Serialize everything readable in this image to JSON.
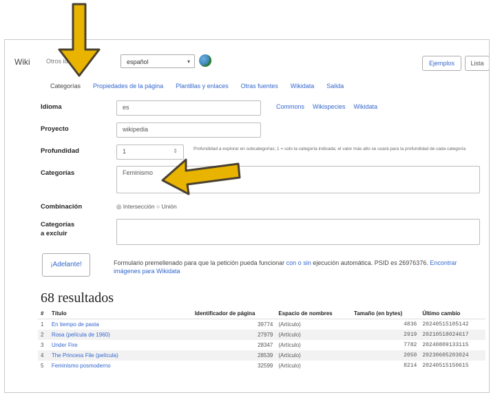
{
  "header": {
    "brand": "Wiki",
    "lang_label": "Otros idiomas",
    "lang_value": "español",
    "examples_btn": "Ejemplos",
    "list_btn": "Lista"
  },
  "tabs": [
    {
      "label": "Categorías",
      "active": true
    },
    {
      "label": "Propiedades de la página",
      "active": false
    },
    {
      "label": "Plantillas y enlaces",
      "active": false
    },
    {
      "label": "Otras fuentes",
      "active": false
    },
    {
      "label": "Wikidata",
      "active": false
    },
    {
      "label": "Salida",
      "active": false
    }
  ],
  "form": {
    "idioma_label": "Idioma",
    "idioma_value": "es",
    "links": [
      "Commons",
      "Wikispecies",
      "Wikidata"
    ],
    "proyecto_label": "Proyecto",
    "proyecto_value": "wikipedia",
    "profundidad_label": "Profundidad",
    "profundidad_value": "1",
    "profundidad_note": "Profundidad a explorar en subcategorías; 1 = solo la categoría indicada; el valor más alto se usará para la profundidad de cada categoría",
    "categorias_label": "Categorías",
    "categorias_value": "Feminismo",
    "combinacion_label": "Combinación",
    "combinacion_options": "◎ Intersección ○ Unión",
    "excluir_label_1": "Categorías",
    "excluir_label_2": "a excluir"
  },
  "action": {
    "go_button": "¡Adelante!",
    "prefill_text": "Formulario premellenado para que la petición pueda funcionar",
    "prefill_link1": "con o sin",
    "prefill_text2": "ejecución automática. PSID es 26976376.",
    "prefill_link2": "Encontrar imágenes para Wikidata"
  },
  "results": {
    "title": "68 resultados",
    "columns": [
      "#",
      "Título",
      "Identificador de página",
      "Espacio de nombres",
      "Tamaño (en bytes)",
      "Último cambio"
    ],
    "rows": [
      [
        "1",
        "En tiempo de pasta",
        "39774",
        "(Artículo)",
        "4836",
        "20240515105142"
      ],
      [
        "2",
        "Rosa (película de 1960)",
        "27979",
        "(Artículo)",
        "2919",
        "20210518024617"
      ],
      [
        "3",
        "Under Fire",
        "28347",
        "(Artículo)",
        "7782",
        "20240809133115"
      ],
      [
        "4",
        "The Princess File (película)",
        "28539",
        "(Artículo)",
        "2050",
        "20230605203024"
      ],
      [
        "5",
        "Feminismo posmoderno",
        "32599",
        "(Artículo)",
        "8214",
        "20240515150615"
      ]
    ]
  },
  "colors": {
    "link": "#3366cc",
    "arrow_fill": "#e8b400",
    "arrow_stroke": "#4a4030"
  }
}
